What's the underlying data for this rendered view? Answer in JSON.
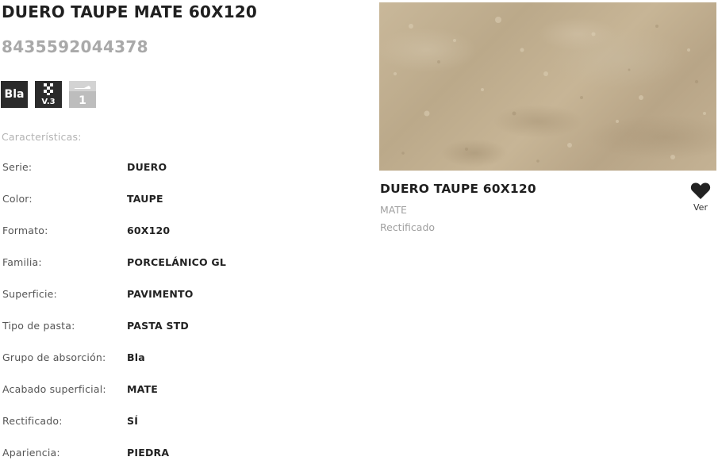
{
  "product": {
    "title": "DUERO TAUPE MATE 60X120",
    "ean": "8435592044378"
  },
  "badges": {
    "absorption": "Bla",
    "variation": "V.3",
    "slip": "1",
    "variation_icon": "shade-variation-icon",
    "slip_icon": "slip-resistance-icon"
  },
  "characteristics": {
    "label": "Características:",
    "rows": [
      {
        "key": "Serie:",
        "value": "DUERO"
      },
      {
        "key": "Color:",
        "value": "TAUPE"
      },
      {
        "key": "Formato:",
        "value": "60X120"
      },
      {
        "key": "Familia:",
        "value": "PORCELÁNICO GL"
      },
      {
        "key": "Superficie:",
        "value": "PAVIMENTO"
      },
      {
        "key": "Tipo de pasta:",
        "value": "PASTA STD"
      },
      {
        "key": "Grupo de absorción:",
        "value": "Bla"
      },
      {
        "key": "Acabado superficial:",
        "value": "MATE"
      },
      {
        "key": "Rectificado:",
        "value": "SÍ"
      },
      {
        "key": "Apariencia:",
        "value": "PIEDRA"
      }
    ]
  },
  "card": {
    "title": "DUERO TAUPE 60X120",
    "finish": "MATE",
    "edge": "Rectificado",
    "favorite_label": "Ver",
    "favorite_icon": "heart-icon"
  },
  "colors": {
    "text_dark": "#1f1f1f",
    "ean_gray": "#a9a9a9",
    "badge_dark": "#2b2b2b",
    "badge_light": "#bdbdbd",
    "muted": "#a0a0a0"
  }
}
